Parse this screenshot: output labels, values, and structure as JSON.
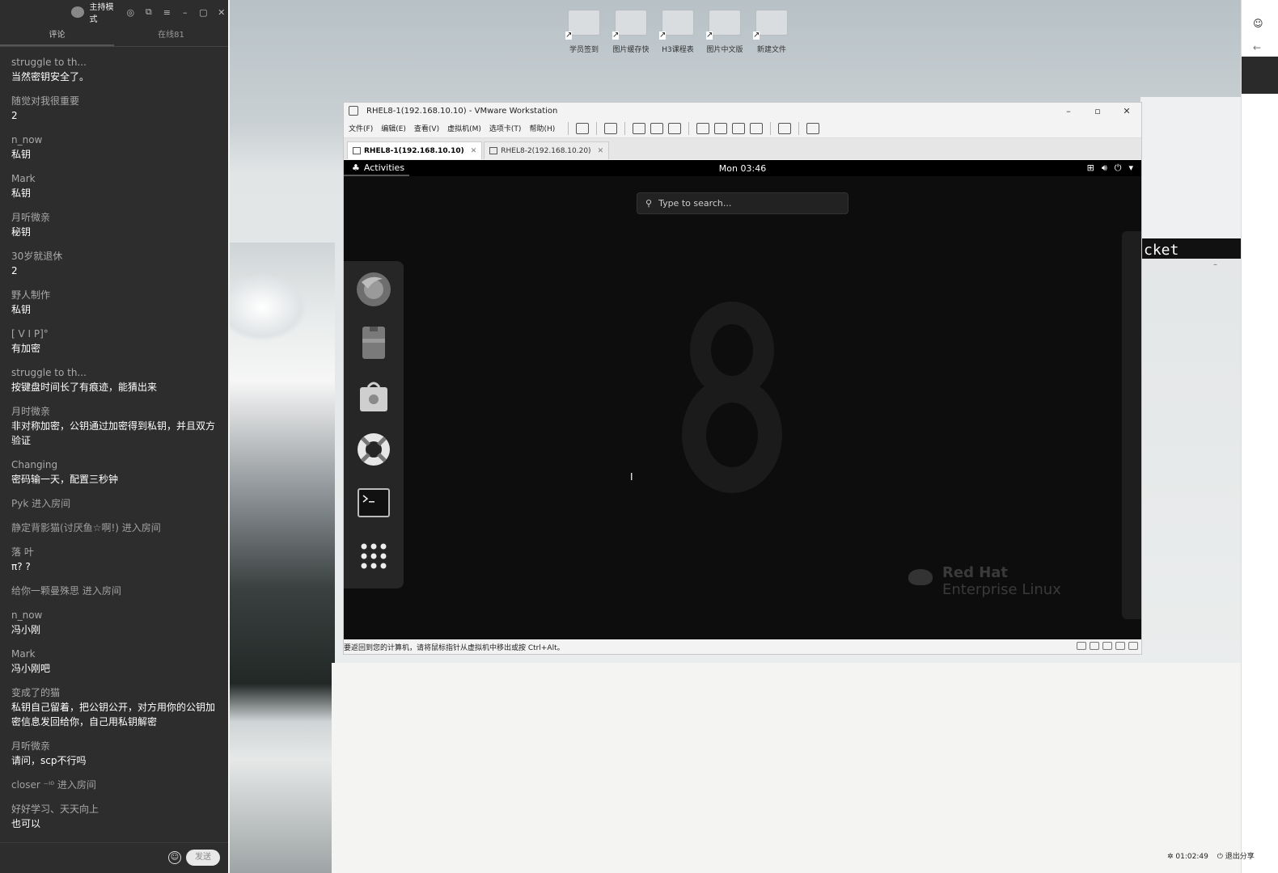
{
  "chat": {
    "title": "主持模式",
    "tabs": [
      "评论",
      "在线81"
    ],
    "messages": [
      {
        "type": "msg",
        "user": "struggle to th...",
        "text": "当然密钥安全了。"
      },
      {
        "type": "msg",
        "user": "随觉对我很重要",
        "text": "2"
      },
      {
        "type": "msg",
        "user": "n_now",
        "text": "私钥"
      },
      {
        "type": "msg",
        "user": "Mark",
        "text": "私钥"
      },
      {
        "type": "msg",
        "user": "月听微亲",
        "text": "秘钥"
      },
      {
        "type": "msg",
        "user": "30岁就退休",
        "text": "2"
      },
      {
        "type": "msg",
        "user": "野人制作",
        "text": "私钥"
      },
      {
        "type": "msg",
        "user": "[ V I P]°",
        "text": "有加密"
      },
      {
        "type": "msg",
        "user": "struggle to th...",
        "text": "按键盘时间长了有痕迹，能猜出来"
      },
      {
        "type": "msg",
        "user": "月时微亲",
        "text": "非对称加密，公钥通过加密得到私钥，并且双方验证"
      },
      {
        "type": "msg",
        "user": "Changing",
        "text": "密码输一天，配置三秒钟"
      },
      {
        "type": "enter",
        "text": "Pyk 进入房间"
      },
      {
        "type": "enter",
        "text": "静定背影猫(讨厌鱼☆啊!) 进入房间"
      },
      {
        "type": "msg",
        "user": "落 叶",
        "text": "π? ?"
      },
      {
        "type": "enter",
        "text": "给你一颗曼殊思 进入房间"
      },
      {
        "type": "msg",
        "user": "n_now",
        "text": "冯小刚"
      },
      {
        "type": "msg",
        "user": "Mark",
        "text": "冯小刚吧"
      },
      {
        "type": "msg",
        "user": "变成了的猫",
        "text": "私钥自己留着，把公钥公开，对方用你的公钥加密信息发回给你，自己用私钥解密"
      },
      {
        "type": "msg",
        "user": "月听微亲",
        "text": "请问，scp不行吗"
      },
      {
        "type": "enter",
        "text": "closer ⁻ᴵ⁰  进入房间"
      },
      {
        "type": "msg",
        "user": "好好学习、天天向上",
        "text": "也可以"
      }
    ],
    "send_label": "发送",
    "emoji_icon": "smiley-icon"
  },
  "desktop": {
    "icons": [
      "学员签到",
      "图片缓存快",
      "H3课程表",
      "图片中文版",
      "新建文件"
    ]
  },
  "vmware": {
    "title": "RHEL8-1(192.168.10.10) - VMware Workstation",
    "window_controls": [
      "–",
      "▫",
      "✕"
    ],
    "menu": [
      "文件(F)",
      "编辑(E)",
      "查看(V)",
      "虚拟机(M)",
      "选项卡(T)",
      "帮助(H)"
    ],
    "tabs": [
      {
        "label": "RHEL8-1(192.168.10.10)",
        "active": true
      },
      {
        "label": "RHEL8-2(192.168.10.20)",
        "active": false
      }
    ],
    "status": "要返回到您的计算机，请将鼠标指针从虚拟机中移出或按 Ctrl+Alt。"
  },
  "guest": {
    "activities": "Activities",
    "clock": "Mon 03:46",
    "search_placeholder": "Type to search...",
    "brand_line1": "Red Hat",
    "brand_line2": "Enterprise Linux",
    "dash": [
      "firefox-icon",
      "files-icon",
      "software-icon",
      "help-icon",
      "terminal-icon",
      "show-apps-icon"
    ]
  },
  "taskbar": {
    "timer": "01:02:49",
    "exit_share": "退出分享"
  },
  "bg_window_fragment": "cket"
}
